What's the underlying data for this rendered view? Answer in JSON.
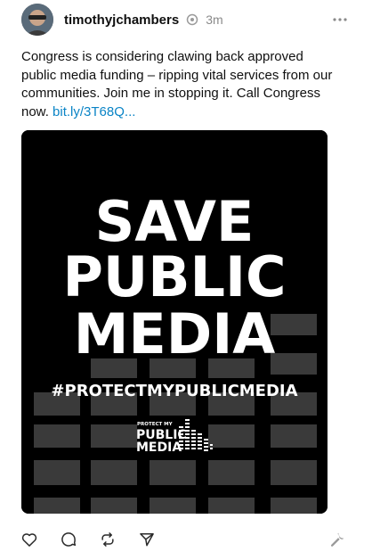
{
  "post": {
    "username": "timothyjchambers",
    "timestamp": "3m",
    "body_text": "Congress is considering clawing back approved public media funding – ripping vital services from our communities. Join me in stopping it. Call Congress now. ",
    "link_text": "bit.ly/3T68Q..."
  },
  "media": {
    "headline_line1": "SAVE",
    "headline_line2": "PUBLIC",
    "headline_line3": "MEDIA",
    "hashtag": "#PROTECTMYPUBLICMEDIA",
    "logo_small": "PROTECT MY",
    "logo_line1": "PUBLIC",
    "logo_line2": "MEDIA"
  },
  "icons": {
    "verified": "verified-badge-icon",
    "more": "more-horizontal-icon",
    "like": "heart-icon",
    "reply": "comment-icon",
    "repost": "repost-icon",
    "share": "send-icon",
    "tools": "wrench-icon"
  },
  "colors": {
    "link": "#0a84c6",
    "media_bg": "#000000",
    "block_fill": "#3a3a3a"
  }
}
